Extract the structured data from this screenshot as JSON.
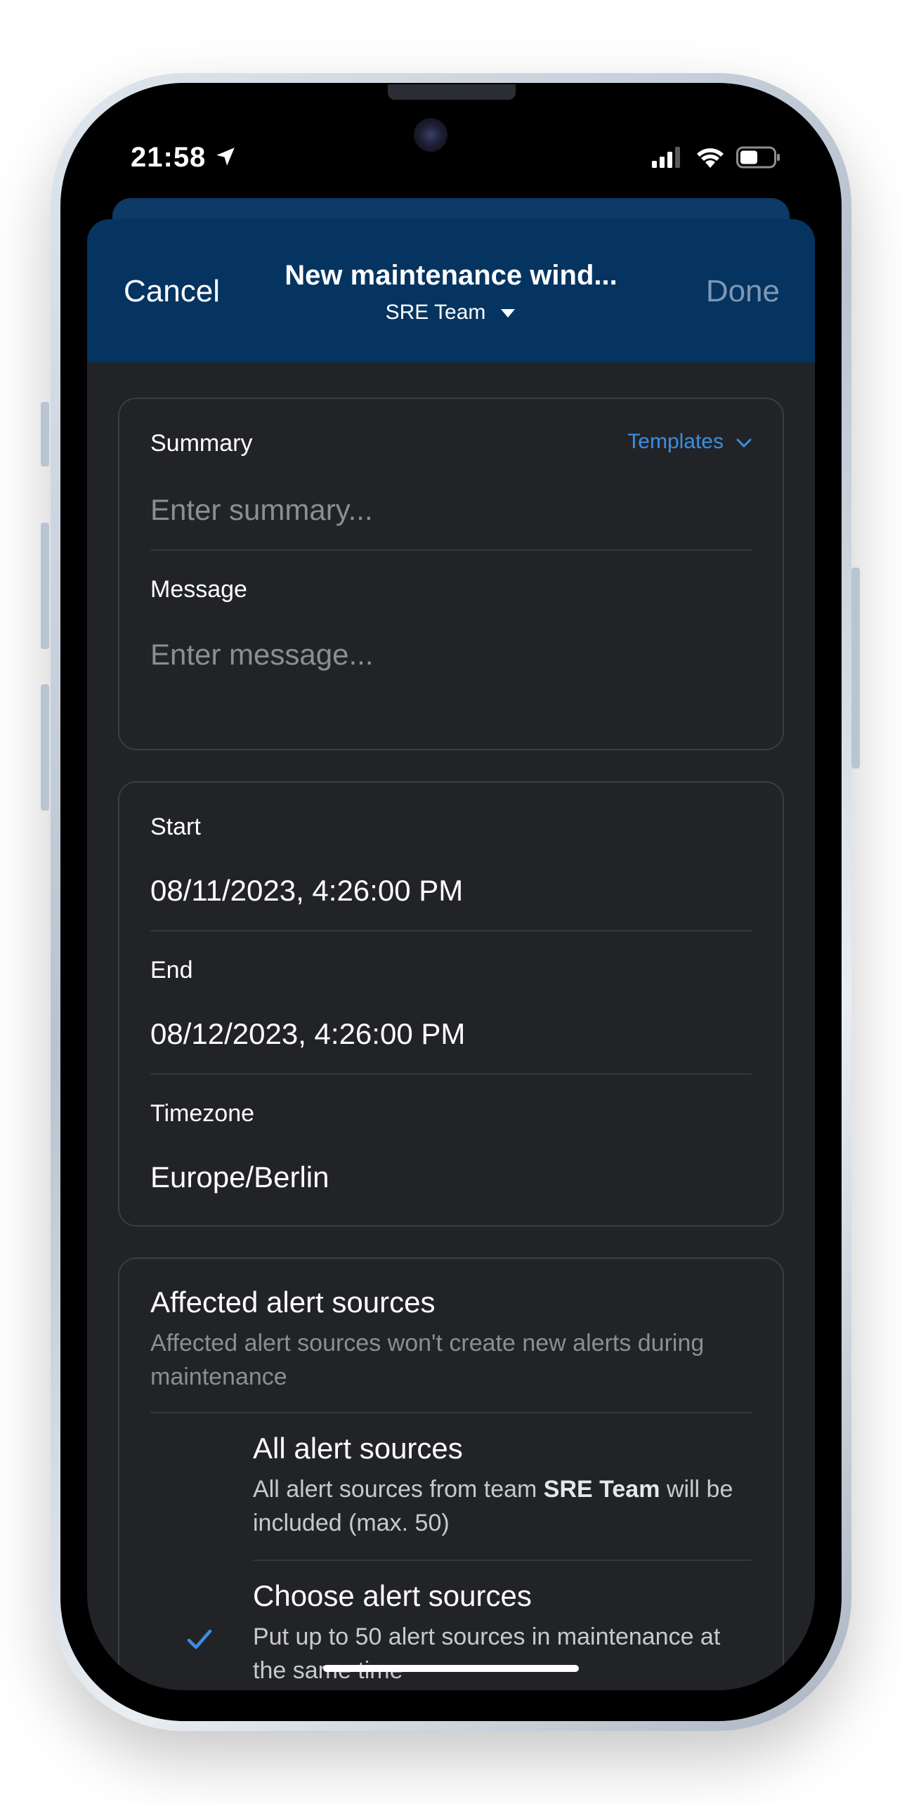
{
  "status": {
    "time": "21:58",
    "icons": [
      "location-arrow-icon",
      "cellular-signal-icon",
      "wifi-icon",
      "battery-icon"
    ]
  },
  "nav": {
    "cancel": "Cancel",
    "title": "New maintenance wind...",
    "team": "SRE Team",
    "done": "Done"
  },
  "summary_card": {
    "summary_label": "Summary",
    "templates": "Templates",
    "summary_placeholder": "Enter summary...",
    "message_label": "Message",
    "message_placeholder": "Enter message..."
  },
  "time_card": {
    "start_label": "Start",
    "start_value": "08/11/2023, 4:26:00 PM",
    "end_label": "End",
    "end_value": "08/12/2023, 4:26:00 PM",
    "timezone_label": "Timezone",
    "timezone_value": "Europe/Berlin"
  },
  "sources_card": {
    "title": "Affected alert sources",
    "description": "Affected alert sources won't create new alerts during maintenance",
    "options": [
      {
        "title": "All alert sources",
        "desc_prefix": "All alert sources from team ",
        "desc_bold": "SRE Team",
        "desc_suffix": " will be included (max. 50)",
        "selected": false
      },
      {
        "title": "Choose alert sources",
        "description": "Put up to 50 alert sources in maintenance at the same time",
        "selected": true
      }
    ]
  },
  "colors": {
    "navbar": "#053461",
    "sheet": "#222327",
    "accent": "#3b8fe0",
    "done_disabled": "#7f97b3"
  }
}
